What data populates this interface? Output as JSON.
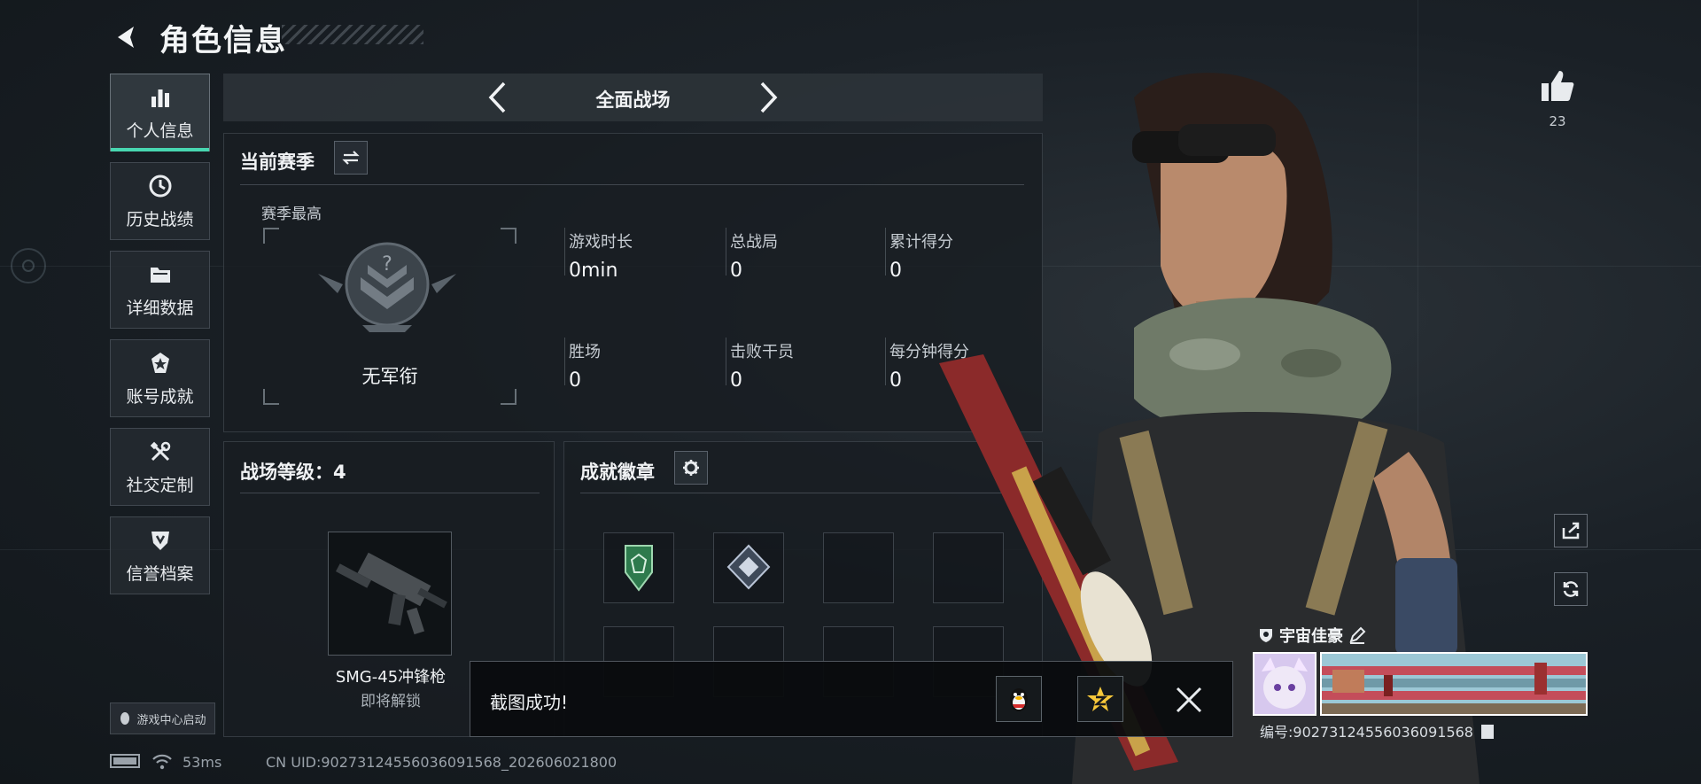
{
  "header": {
    "title": "角色信息"
  },
  "sidebar": {
    "items": [
      {
        "label": "个人信息",
        "icon": "bar-chart-icon",
        "active": true
      },
      {
        "label": "历史战绩",
        "icon": "clock-icon"
      },
      {
        "label": "详细数据",
        "icon": "folder-icon"
      },
      {
        "label": "账号成就",
        "icon": "achievement-icon"
      },
      {
        "label": "社交定制",
        "icon": "tools-icon"
      },
      {
        "label": "信誉档案",
        "icon": "credit-shield-icon"
      }
    ],
    "launch_label": "游戏中心启动"
  },
  "mode": {
    "title": "全面战场"
  },
  "season": {
    "title": "当前赛季",
    "best_label": "赛季最高",
    "rank_name": "无军衔",
    "stats": [
      {
        "label": "游戏时长",
        "value": "0min"
      },
      {
        "label": "总战局",
        "value": "0"
      },
      {
        "label": "累计得分",
        "value": "0"
      },
      {
        "label": "胜场",
        "value": "0"
      },
      {
        "label": "击败干员",
        "value": "0"
      },
      {
        "label": "每分钟得分",
        "value": "0"
      }
    ]
  },
  "battlefield": {
    "level_label": "战场等级：4",
    "weapon_name": "SMG-45冲锋枪",
    "weapon_status": "即将解锁"
  },
  "achievements": {
    "title": "成就徽章"
  },
  "likes": {
    "count": "23"
  },
  "player": {
    "name": "宇宙佳豪",
    "id_text": "编号:90273124556036091568"
  },
  "toast": {
    "message": "截图成功!"
  },
  "status_bar": {
    "ping": "53ms",
    "uid": "CN UID:90273124556036091568_202606021800"
  },
  "colors": {
    "accent": "#48d6b0",
    "panel": "#181d22"
  }
}
